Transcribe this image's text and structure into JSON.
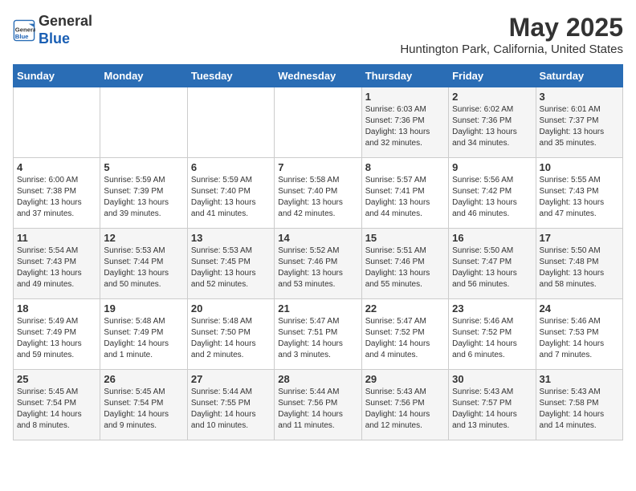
{
  "header": {
    "logo_line1": "General",
    "logo_line2": "Blue",
    "month": "May 2025",
    "location": "Huntington Park, California, United States"
  },
  "weekdays": [
    "Sunday",
    "Monday",
    "Tuesday",
    "Wednesday",
    "Thursday",
    "Friday",
    "Saturday"
  ],
  "weeks": [
    [
      {
        "day": "",
        "info": ""
      },
      {
        "day": "",
        "info": ""
      },
      {
        "day": "",
        "info": ""
      },
      {
        "day": "",
        "info": ""
      },
      {
        "day": "1",
        "info": "Sunrise: 6:03 AM\nSunset: 7:36 PM\nDaylight: 13 hours\nand 32 minutes."
      },
      {
        "day": "2",
        "info": "Sunrise: 6:02 AM\nSunset: 7:36 PM\nDaylight: 13 hours\nand 34 minutes."
      },
      {
        "day": "3",
        "info": "Sunrise: 6:01 AM\nSunset: 7:37 PM\nDaylight: 13 hours\nand 35 minutes."
      }
    ],
    [
      {
        "day": "4",
        "info": "Sunrise: 6:00 AM\nSunset: 7:38 PM\nDaylight: 13 hours\nand 37 minutes."
      },
      {
        "day": "5",
        "info": "Sunrise: 5:59 AM\nSunset: 7:39 PM\nDaylight: 13 hours\nand 39 minutes."
      },
      {
        "day": "6",
        "info": "Sunrise: 5:59 AM\nSunset: 7:40 PM\nDaylight: 13 hours\nand 41 minutes."
      },
      {
        "day": "7",
        "info": "Sunrise: 5:58 AM\nSunset: 7:40 PM\nDaylight: 13 hours\nand 42 minutes."
      },
      {
        "day": "8",
        "info": "Sunrise: 5:57 AM\nSunset: 7:41 PM\nDaylight: 13 hours\nand 44 minutes."
      },
      {
        "day": "9",
        "info": "Sunrise: 5:56 AM\nSunset: 7:42 PM\nDaylight: 13 hours\nand 46 minutes."
      },
      {
        "day": "10",
        "info": "Sunrise: 5:55 AM\nSunset: 7:43 PM\nDaylight: 13 hours\nand 47 minutes."
      }
    ],
    [
      {
        "day": "11",
        "info": "Sunrise: 5:54 AM\nSunset: 7:43 PM\nDaylight: 13 hours\nand 49 minutes."
      },
      {
        "day": "12",
        "info": "Sunrise: 5:53 AM\nSunset: 7:44 PM\nDaylight: 13 hours\nand 50 minutes."
      },
      {
        "day": "13",
        "info": "Sunrise: 5:53 AM\nSunset: 7:45 PM\nDaylight: 13 hours\nand 52 minutes."
      },
      {
        "day": "14",
        "info": "Sunrise: 5:52 AM\nSunset: 7:46 PM\nDaylight: 13 hours\nand 53 minutes."
      },
      {
        "day": "15",
        "info": "Sunrise: 5:51 AM\nSunset: 7:46 PM\nDaylight: 13 hours\nand 55 minutes."
      },
      {
        "day": "16",
        "info": "Sunrise: 5:50 AM\nSunset: 7:47 PM\nDaylight: 13 hours\nand 56 minutes."
      },
      {
        "day": "17",
        "info": "Sunrise: 5:50 AM\nSunset: 7:48 PM\nDaylight: 13 hours\nand 58 minutes."
      }
    ],
    [
      {
        "day": "18",
        "info": "Sunrise: 5:49 AM\nSunset: 7:49 PM\nDaylight: 13 hours\nand 59 minutes."
      },
      {
        "day": "19",
        "info": "Sunrise: 5:48 AM\nSunset: 7:49 PM\nDaylight: 14 hours\nand 1 minute."
      },
      {
        "day": "20",
        "info": "Sunrise: 5:48 AM\nSunset: 7:50 PM\nDaylight: 14 hours\nand 2 minutes."
      },
      {
        "day": "21",
        "info": "Sunrise: 5:47 AM\nSunset: 7:51 PM\nDaylight: 14 hours\nand 3 minutes."
      },
      {
        "day": "22",
        "info": "Sunrise: 5:47 AM\nSunset: 7:52 PM\nDaylight: 14 hours\nand 4 minutes."
      },
      {
        "day": "23",
        "info": "Sunrise: 5:46 AM\nSunset: 7:52 PM\nDaylight: 14 hours\nand 6 minutes."
      },
      {
        "day": "24",
        "info": "Sunrise: 5:46 AM\nSunset: 7:53 PM\nDaylight: 14 hours\nand 7 minutes."
      }
    ],
    [
      {
        "day": "25",
        "info": "Sunrise: 5:45 AM\nSunset: 7:54 PM\nDaylight: 14 hours\nand 8 minutes."
      },
      {
        "day": "26",
        "info": "Sunrise: 5:45 AM\nSunset: 7:54 PM\nDaylight: 14 hours\nand 9 minutes."
      },
      {
        "day": "27",
        "info": "Sunrise: 5:44 AM\nSunset: 7:55 PM\nDaylight: 14 hours\nand 10 minutes."
      },
      {
        "day": "28",
        "info": "Sunrise: 5:44 AM\nSunset: 7:56 PM\nDaylight: 14 hours\nand 11 minutes."
      },
      {
        "day": "29",
        "info": "Sunrise: 5:43 AM\nSunset: 7:56 PM\nDaylight: 14 hours\nand 12 minutes."
      },
      {
        "day": "30",
        "info": "Sunrise: 5:43 AM\nSunset: 7:57 PM\nDaylight: 14 hours\nand 13 minutes."
      },
      {
        "day": "31",
        "info": "Sunrise: 5:43 AM\nSunset: 7:58 PM\nDaylight: 14 hours\nand 14 minutes."
      }
    ]
  ]
}
